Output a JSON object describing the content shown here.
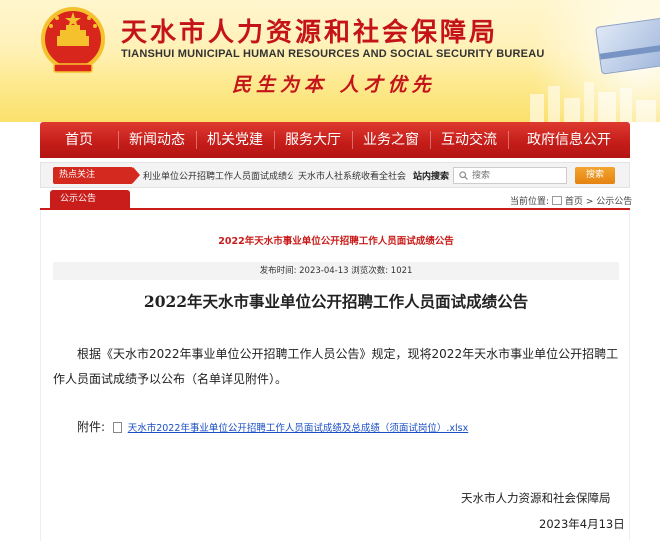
{
  "banner": {
    "title_cn": "天水市人力资源和社会保障局",
    "title_en": "TIANSHUI MUNICIPAL HUMAN RESOURCES AND SOCIAL SECURITY BUREAU",
    "slogan": "民生为本  人才优先"
  },
  "nav": {
    "items": [
      "首页",
      "新闻动态",
      "机关党建",
      "服务大厅",
      "业务之窗",
      "互动交流",
      "政府信息公开"
    ]
  },
  "subbar": {
    "hot_label": "热点关注",
    "hot_news_1": "利业单位公开招聘工作人员面试成绩公告",
    "hot_news_2": "天水市人社系统收看全社会",
    "search_label": "站内搜索",
    "search_placeholder": "搜索",
    "search_button": "搜索"
  },
  "section": {
    "tab_label": "公示公告",
    "breadcrumb_prefix": "当前位置:",
    "breadcrumb_home": "首页",
    "breadcrumb_sep": ">",
    "breadcrumb_current": "公示公告"
  },
  "article": {
    "red_title": "2022年天水市事业单位公开招聘工作人员面试成绩公告",
    "meta": "发布时间:  2023-04-13     浏览次数:  1021",
    "main_title": "2022年天水市事业单位公开招聘工作人员面试成绩公告",
    "body": "根据《天水市2022年事业单位公开招聘工作人员公告》规定，现将2022年天水市事业单位公开招聘工作人员面试成绩予以公布（名单详见附件）。",
    "attachment_label": "附件:",
    "attachment_link": "天水市2022年事业单位公开招聘工作人员面试成绩及总成绩（须面试岗位）.xlsx",
    "signature_org": "天水市人力资源和社会保障局",
    "signature_date": "2023年4月13日"
  },
  "colors": {
    "brand_red": "#c81d1a",
    "link_blue": "#1a4fc4",
    "search_orange": "#e58311"
  }
}
